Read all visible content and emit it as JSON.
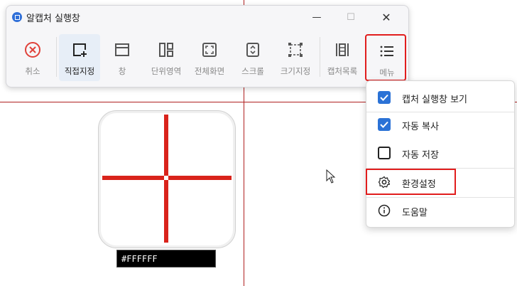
{
  "window": {
    "title": "알캡처 실행창",
    "controls": {
      "minimize": "—",
      "maximize": "☐",
      "close": "✕"
    }
  },
  "toolbar": {
    "items": [
      {
        "label": "취소",
        "icon": "cancel-icon"
      },
      {
        "label": "직접지정",
        "icon": "custom-region-icon",
        "active": true
      },
      {
        "label": "창",
        "icon": "window-icon"
      },
      {
        "label": "단위영역",
        "icon": "unit-region-icon"
      },
      {
        "label": "전체화면",
        "icon": "fullscreen-icon"
      },
      {
        "label": "스크롤",
        "icon": "scroll-icon"
      },
      {
        "label": "크기지정",
        "icon": "fixed-size-icon"
      },
      {
        "label": "캡처목록",
        "icon": "capture-list-icon"
      },
      {
        "label": "메뉴",
        "icon": "hamburger-icon",
        "highlighted": true
      }
    ]
  },
  "menu": {
    "items": [
      {
        "label": "캡처 실행창 보기",
        "type": "checkbox",
        "checked": true
      },
      {
        "label": "자동 복사",
        "type": "checkbox",
        "checked": true
      },
      {
        "label": "자동 저장",
        "type": "checkbox",
        "checked": false
      },
      {
        "label": "환경설정",
        "type": "action",
        "icon": "gear-icon",
        "highlighted": true
      },
      {
        "label": "도움말",
        "type": "action",
        "icon": "info-icon"
      }
    ]
  },
  "magnifier": {
    "color_hex_label": "#FFFFFF"
  },
  "colors": {
    "accent": "#2b72d6",
    "highlight": "#e11d1d",
    "crosshair": "#d9231b",
    "cancel": "#e0413a"
  }
}
